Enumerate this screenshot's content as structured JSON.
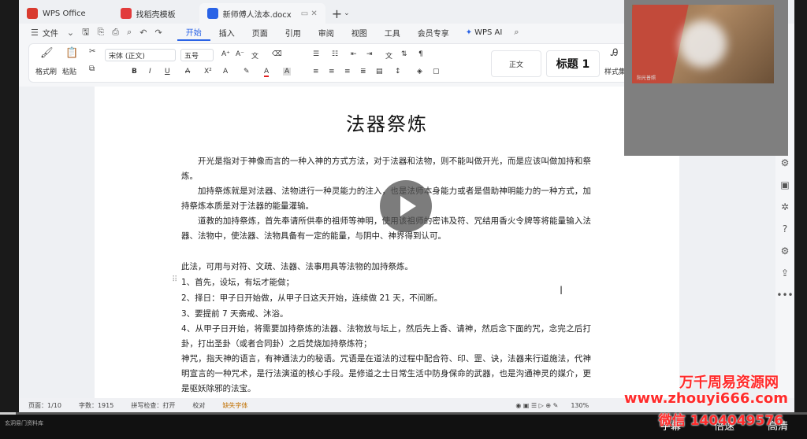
{
  "tabs": [
    {
      "label": "WPS Office",
      "color": "#d93a2e"
    },
    {
      "label": "找稻壳模板",
      "color": "#e23b3b"
    },
    {
      "label": "新师傅人法本.docx",
      "color": "#2a63e6"
    }
  ],
  "menu": {
    "file": "文件",
    "items": [
      "开始",
      "插入",
      "页面",
      "引用",
      "审阅",
      "视图",
      "工具",
      "会员专享"
    ],
    "active": "开始",
    "ai": "WPS AI"
  },
  "ribbon": {
    "format_painter": "格式刷",
    "paste": "粘贴",
    "font_name": "宋体 (正文)",
    "font_size": "五号",
    "style_normal": "正文",
    "style_h1": "标题 1",
    "style_set": "样式集"
  },
  "document": {
    "title": "法器祭炼",
    "paragraphs": [
      "开光是指对于神像而言的一种入神的方式方法，对于法器和法物，则不能叫做开光，而是应该叫做加持和祭炼。",
      "加持祭炼就是对法器、法物进行一种灵能力的注入，也是法师本身能力或者是借助神明能力的一种方式，加持祭炼本质是对于法器的能量灌输。",
      "道教的加持祭炼，首先奉请所供奉的祖师等神明，使用该祖师的密讳及符、咒结用香火令牌等将能量输入法器、法物中，使法器、法物具备有一定的能量，与阴中、神界得到认可。",
      "此法，可用与对符、文疏、法器、法事用具等法物的加持祭炼。",
      "1、首先，设坛，有坛才能做；",
      "2、择日：甲子日开始做，从甲子日这天开始，连续做 21 天，不间断。",
      "3、要提前 7 天斋戒、沐浴。",
      "4、从甲子日开始，将需要加持祭炼的法器、法物放与坛上，然后先上香、请神，然后念下面的咒，念完之后打卦，打出圣卦（或者合同卦）之后焚烧加持祭炼符；",
      "神咒，指天神的语言，有神通法力的秘语。咒语是在道法的过程中配合符、印、罡、诀，法器来行道施法，代神明宣言的一种咒术，是行法演道的核心手段。是修道之士日常生活中防身保命的武器，也是沟通神灵的媒介，更是驱妖除邪的法宝。"
    ]
  },
  "statusbar": {
    "page": "页面：1/10",
    "words": "字数：1915",
    "spell": "拼写检查：打开",
    "proofread": "校对",
    "missing_font": "缺失字体",
    "zoom": "130%"
  },
  "webcam": {
    "label": "阳光普照"
  },
  "player": {
    "channel": "玄洞易门资料库",
    "subtitle": "字幕",
    "speed": "倍速",
    "quality": "高清",
    "progress": 0.02
  },
  "watermark": {
    "line1": "万千周易资源网",
    "line2": "www.zhouyi666.com",
    "line3": "微信 1404049576"
  }
}
